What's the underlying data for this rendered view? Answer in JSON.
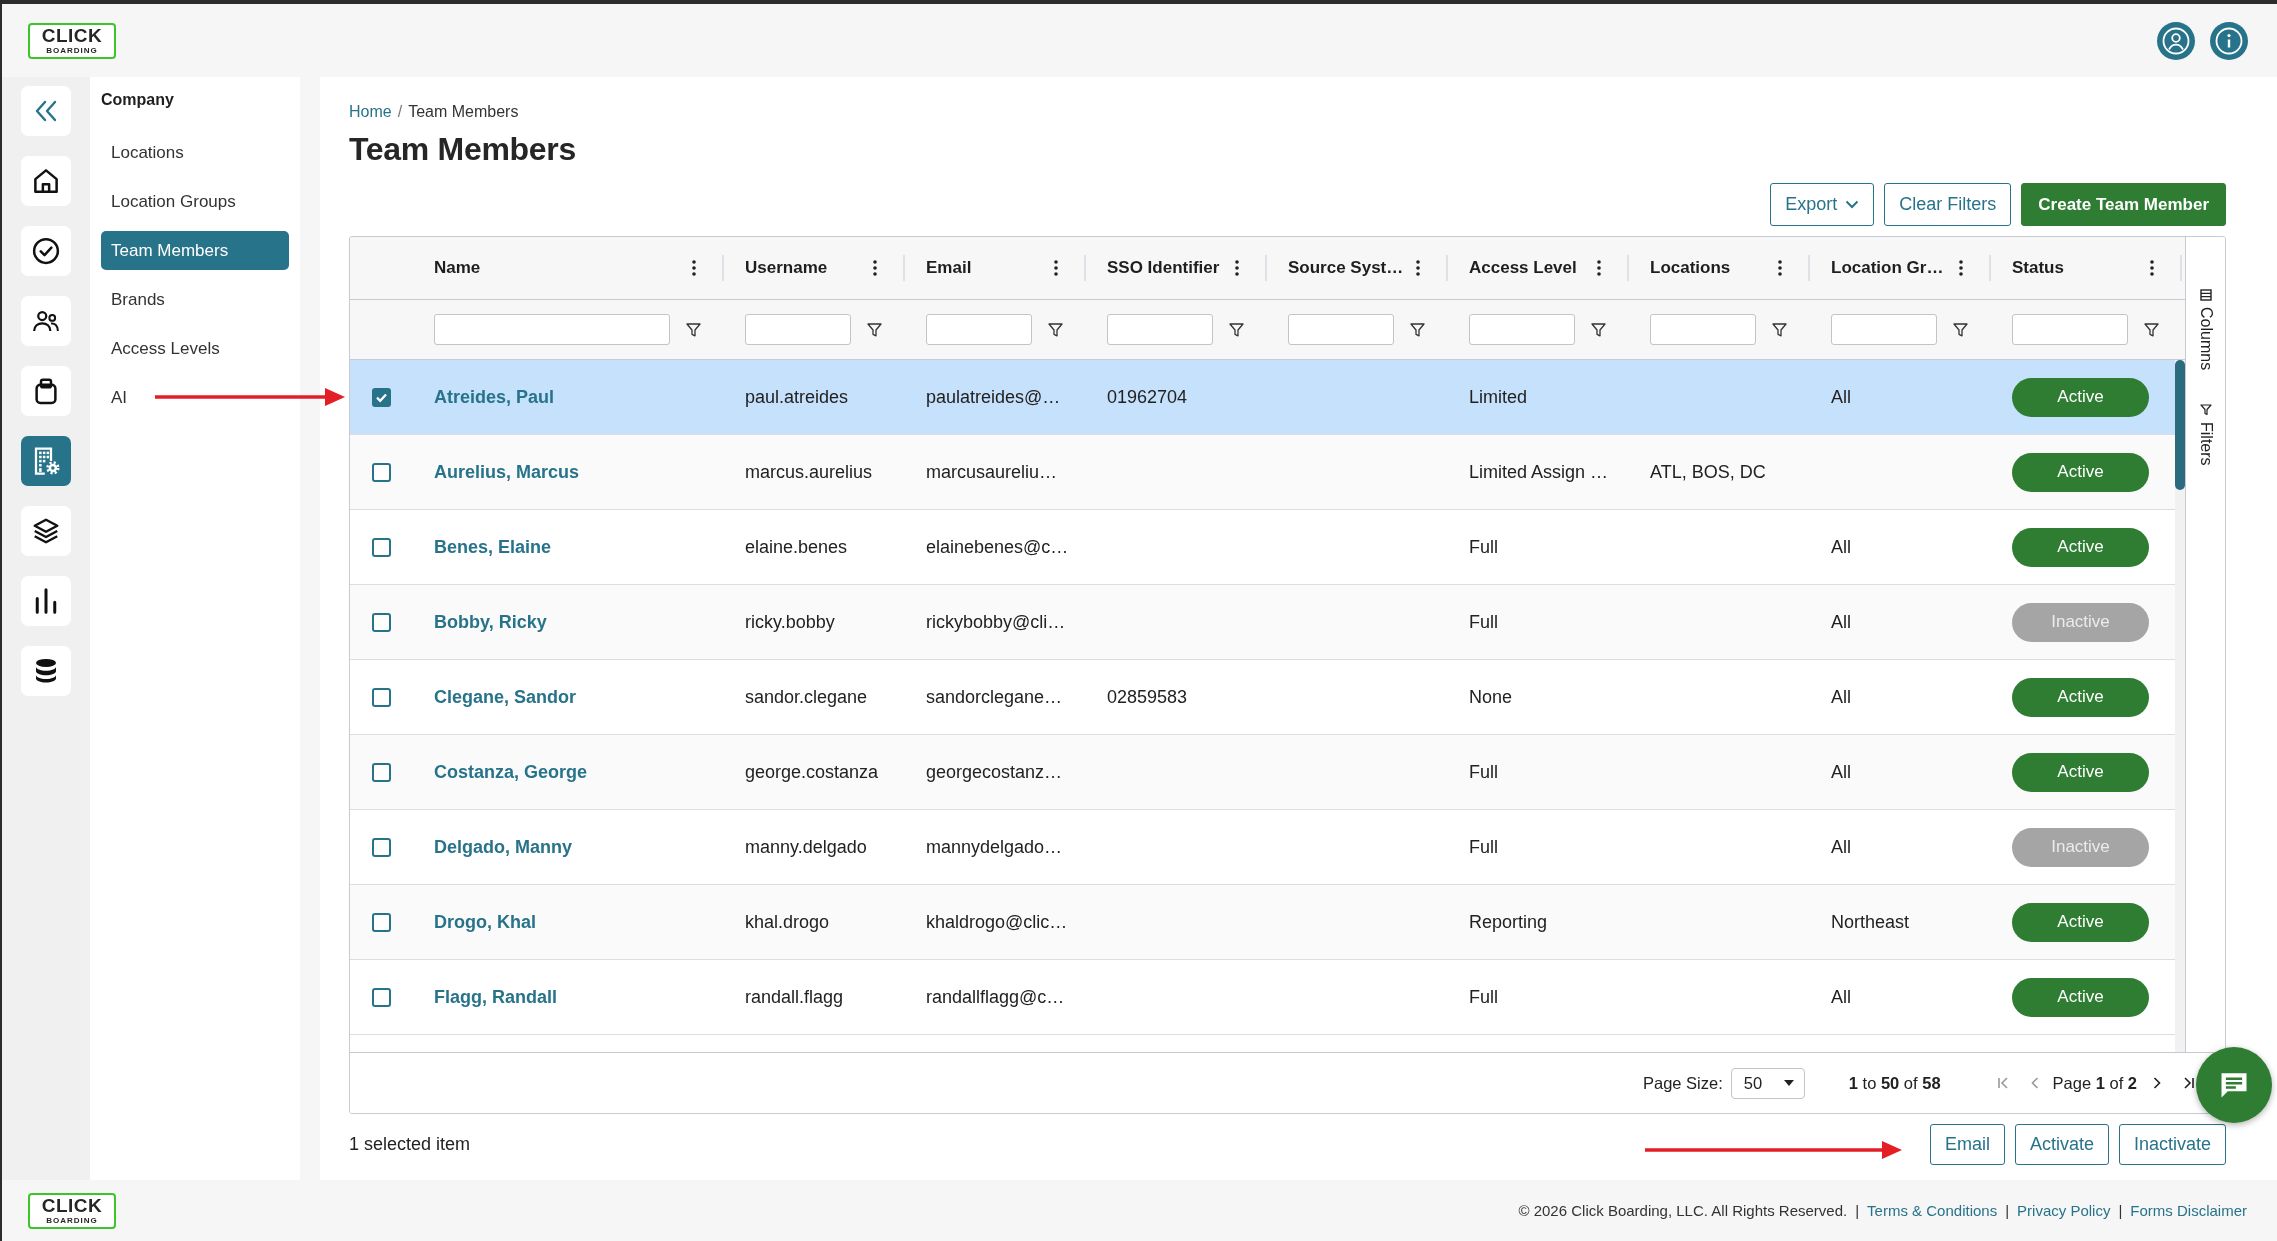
{
  "header": {
    "logo": {
      "wordmark": "CLICK",
      "tagline": "BOARDING"
    }
  },
  "rail": [
    {
      "selected": false
    },
    {
      "selected": false
    },
    {
      "selected": false
    },
    {
      "selected": false
    },
    {
      "selected": true
    },
    {
      "selected": false
    },
    {
      "selected": false
    },
    {
      "selected": false
    }
  ],
  "subnav": {
    "title": "Company",
    "items": [
      {
        "label": "Locations",
        "selected": false
      },
      {
        "label": "Location Groups",
        "selected": false
      },
      {
        "label": "Team Members",
        "selected": true
      },
      {
        "label": "Brands",
        "selected": false
      },
      {
        "label": "Access Levels",
        "selected": false
      },
      {
        "label": "AI",
        "selected": false
      }
    ]
  },
  "breadcrumb": [
    {
      "kind": "link",
      "text": "Home"
    },
    {
      "kind": "separator",
      "text": "/"
    },
    {
      "kind": "current",
      "text": "Team Members"
    }
  ],
  "title": "Team Members",
  "toolbar": [
    {
      "label": "Export",
      "kind": "dropdown"
    },
    {
      "label": "Clear Filters",
      "kind": "outline"
    },
    {
      "label": "Create Team Member",
      "kind": "primary"
    }
  ],
  "grid": {
    "columns": [
      {
        "label": "Name",
        "kind": "link"
      },
      {
        "label": "Username",
        "kind": "text"
      },
      {
        "label": "Email",
        "kind": "text"
      },
      {
        "label": "SSO Identifier",
        "kind": "text"
      },
      {
        "label": "Source Syst…",
        "kind": "text"
      },
      {
        "label": "Access Level",
        "kind": "text"
      },
      {
        "label": "Locations",
        "kind": "text"
      },
      {
        "label": "Location Gr…",
        "kind": "text"
      },
      {
        "label": "Status",
        "kind": "status"
      }
    ],
    "rows": [
      {
        "selected": true,
        "name": "Atreides, Paul",
        "username": "paul.atreides",
        "email": "paulatreides@…",
        "sso_identifier": "01962704",
        "access_level": "Limited",
        "location_group": "All",
        "status": {
          "label": "Active",
          "active": true
        }
      },
      {
        "selected": false,
        "name": "Aurelius, Marcus",
        "username": "marcus.aurelius",
        "email": "marcusaureliu…",
        "access_level": "Limited Assign …",
        "locations": "ATL, BOS, DC",
        "status": {
          "label": "Active",
          "active": true
        }
      },
      {
        "selected": false,
        "name": "Benes, Elaine",
        "username": "elaine.benes",
        "email": "elainebenes@c…",
        "access_level": "Full",
        "location_group": "All",
        "status": {
          "label": "Active",
          "active": true
        }
      },
      {
        "selected": false,
        "name": "Bobby, Ricky",
        "username": "ricky.bobby",
        "email": "rickybobby@cli…",
        "access_level": "Full",
        "location_group": "All",
        "status": {
          "label": "Inactive",
          "active": false
        }
      },
      {
        "selected": false,
        "name": "Clegane, Sandor",
        "username": "sandor.clegane",
        "email": "sandorclegane…",
        "sso_identifier": "02859583",
        "access_level": "None",
        "location_group": "All",
        "status": {
          "label": "Active",
          "active": true
        }
      },
      {
        "selected": false,
        "name": "Costanza, George",
        "username": "george.costanza",
        "email": "georgecostanz…",
        "access_level": "Full",
        "location_group": "All",
        "status": {
          "label": "Active",
          "active": true
        }
      },
      {
        "selected": false,
        "name": "Delgado, Manny",
        "username": "manny.delgado",
        "email": "mannydelgado…",
        "access_level": "Full",
        "location_group": "All",
        "status": {
          "label": "Inactive",
          "active": false
        }
      },
      {
        "selected": false,
        "name": "Drogo, Khal",
        "username": "khal.drogo",
        "email": "khaldrogo@clic…",
        "access_level": "Reporting",
        "location_group": "Northeast",
        "status": {
          "label": "Active",
          "active": true
        }
      },
      {
        "selected": false,
        "name": "Flagg, Randall",
        "username": "randall.flagg",
        "email": "randallflagg@c…",
        "access_level": "Full",
        "location_group": "All",
        "status": {
          "label": "Active",
          "active": true
        }
      }
    ],
    "side_panel": [
      {
        "label": "Columns"
      },
      {
        "label": "Filters"
      }
    ],
    "pagination": {
      "page_size_label": "Page Size:",
      "page_size": "50",
      "range": "**1** to **50** of **58**",
      "first": {
        "disabled": true
      },
      "previous": {
        "disabled": true
      },
      "page": "Page **1** of **2**",
      "next": {
        "disabled": false
      },
      "last": {
        "disabled": false
      }
    }
  },
  "selection_summary": "1 selected item",
  "actions": [
    "Email",
    "Activate",
    "Inactivate"
  ],
  "footer": {
    "logo": {
      "wordmark": "CLICK",
      "tagline": "BOARDING"
    },
    "items": [
      {
        "kind": "text",
        "text": "© 2026 Click Boarding, LLC. All Rights Reserved."
      },
      {
        "kind": "separator",
        "text": "|"
      },
      {
        "kind": "link",
        "text": "Terms & Conditions"
      },
      {
        "kind": "separator",
        "text": "|"
      },
      {
        "kind": "link",
        "text": "Privacy Policy"
      },
      {
        "kind": "separator",
        "text": "|"
      },
      {
        "kind": "link",
        "text": "Forms Disclaimer"
      }
    ]
  }
}
